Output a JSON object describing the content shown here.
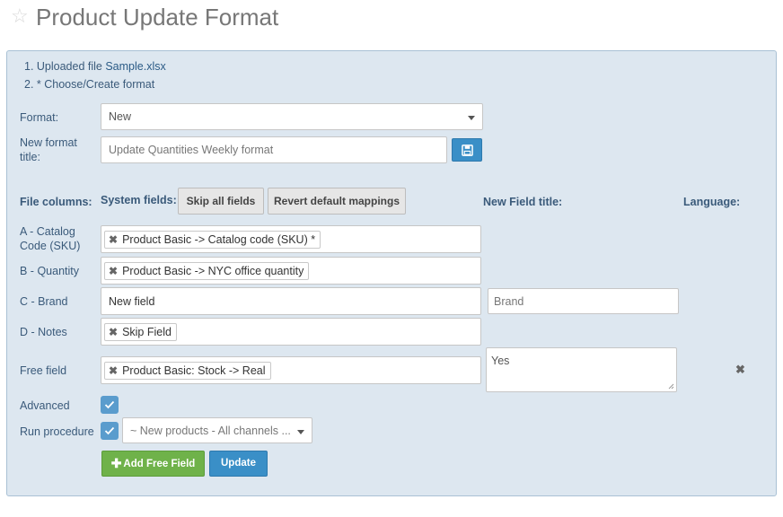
{
  "page": {
    "title": "Product Update Format"
  },
  "steps": {
    "step1_prefix": "1. Uploaded file ",
    "step1_file": "Sample.xlsx",
    "step2": "2. * Choose/Create format"
  },
  "format": {
    "label": "Format:",
    "value": "New"
  },
  "new_format": {
    "label": "New format title:",
    "value": "Update Quantities Weekly format"
  },
  "headers": {
    "file_columns": "File columns:",
    "system_fields": "System fields:",
    "skip_all": "Skip all fields",
    "revert": "Revert default mappings",
    "new_field_title": "New Field title:",
    "language": "Language:"
  },
  "rows": [
    {
      "label": "A - Catalog Code (SKU)",
      "tag": "Product Basic -> Catalog code (SKU) *"
    },
    {
      "label": "B - Quantity",
      "tag": "Product Basic -> NYC office quantity"
    },
    {
      "label": "C - Brand",
      "text": "New field",
      "new_title_placeholder": "Brand"
    },
    {
      "label": "D - Notes",
      "tag": "Skip Field"
    },
    {
      "label": "Free field",
      "tag": "Product Basic: Stock -> Real",
      "textarea_value": "Yes"
    }
  ],
  "advanced": {
    "label": "Advanced",
    "checked": true
  },
  "run_procedure": {
    "label": "Run procedure",
    "checked": true,
    "select_value": "~ New products - All channels ..."
  },
  "actions": {
    "add_free_field": "Add Free Field",
    "update": "Update"
  },
  "colors": {
    "panel_bg": "#dde7f0",
    "primary": "#3a8fc7",
    "success": "#6fb24a",
    "checkbox": "#5a9ccd"
  },
  "icons": {
    "title": "star-outline-icon",
    "save": "floppy-disk-icon",
    "remove": "close-icon",
    "add": "plus-icon"
  }
}
